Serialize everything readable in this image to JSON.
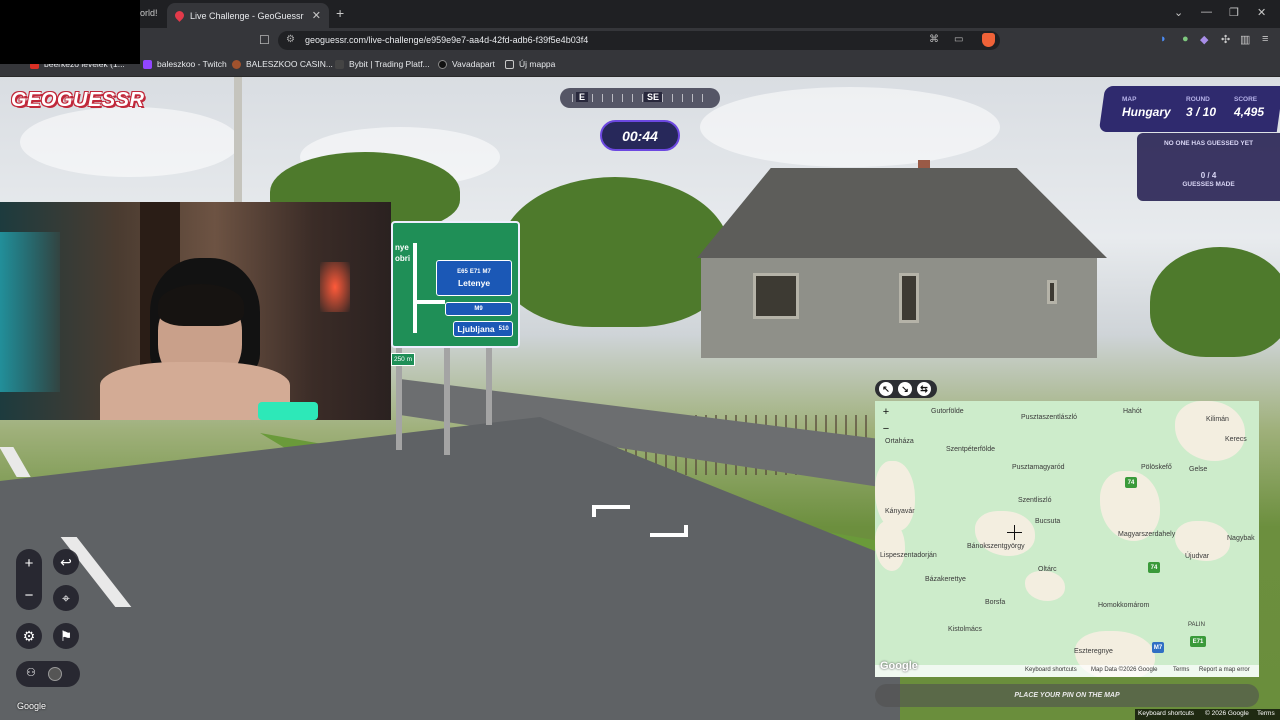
{
  "browser": {
    "prev_tab_title": "orld!",
    "active_tab_title": "Live Challenge - GeoGuessr",
    "url": "geoguessr.com/live-challenge/e959e9e7-aa4d-42fd-adb6-f39f5e4b03f4",
    "bookmarks": [
      {
        "label": "beerkezo levelek (1...",
        "color": "#d93025"
      },
      {
        "label": "baleszkoo - Twitch",
        "color": "#9146ff"
      },
      {
        "label": "BALESZKOO CASIN...",
        "color": "#a0522d"
      },
      {
        "label": "Bybit | Trading Platf...",
        "color": "#222222"
      },
      {
        "label": "Vavadapart",
        "color": "#111111"
      },
      {
        "label": "Új mappa",
        "color": "#c8c8c8"
      }
    ]
  },
  "game": {
    "logo": "GEOGUESSR",
    "compass": {
      "left_label": "E",
      "center_label": "SE"
    },
    "timer": "00:44",
    "status": {
      "map_label": "MAP",
      "map_value": "Hungary",
      "round_label": "ROUND",
      "round_value": "3 / 10",
      "score_label": "SCORE",
      "score_value": "4,495"
    },
    "guess_panel": {
      "no_guess_text": "NO ONE HAS GUESSED YET",
      "count": "0 / 4",
      "made_label": "GUESSES MADE"
    },
    "place_pin": "PLACE YOUR PIN ON THE MAP",
    "google_watermark": "Google"
  },
  "sign": {
    "top_left": "nye",
    "top_left2": "obri",
    "route_codes": [
      "E65",
      "E71",
      "M7",
      "M9"
    ],
    "dest_1": "Letenye",
    "dest_2": "Ljubljana",
    "dest_2_num": "510",
    "distance": "250 m"
  },
  "map": {
    "towns": [
      {
        "name": "Gutorfölde"
      },
      {
        "name": "Pusztaszentlászló"
      },
      {
        "name": "Hahót"
      },
      {
        "name": "Kilimán"
      },
      {
        "name": "Kerecs"
      },
      {
        "name": "Ortaháza"
      },
      {
        "name": "Szentpéterfölde"
      },
      {
        "name": "Pusztamagyaród"
      },
      {
        "name": "Pölöskefő"
      },
      {
        "name": "Gelse"
      },
      {
        "name": "Szentliszló"
      },
      {
        "name": "Kányavár"
      },
      {
        "name": "Bucsuta"
      },
      {
        "name": "Magyarszerdahely"
      },
      {
        "name": "Nagybak"
      },
      {
        "name": "Bánokszentgyörgy"
      },
      {
        "name": "Lispeszentadorján"
      },
      {
        "name": "Újudvar"
      },
      {
        "name": "Oltárc"
      },
      {
        "name": "Bázakerettye"
      },
      {
        "name": "Borsfa"
      },
      {
        "name": "Homokkomárom"
      },
      {
        "name": "Kistolmács"
      },
      {
        "name": "PALIN"
      },
      {
        "name": "Eszteregnye"
      }
    ],
    "routes": [
      {
        "label": "74",
        "color": "#3a9a3a"
      },
      {
        "label": "74",
        "color": "#3a9a3a"
      },
      {
        "label": "M7",
        "color": "#2f6fc4"
      },
      {
        "label": "E71",
        "color": "#3a9a3a"
      }
    ],
    "footer": [
      "Keyboard shortcuts",
      "Map Data ©2026 Google",
      "Terms",
      "Report a map error"
    ],
    "google_logo": "Google"
  },
  "bottom_bar": [
    "Keyboard shortcuts",
    "© 2026 Google",
    "Terms"
  ]
}
